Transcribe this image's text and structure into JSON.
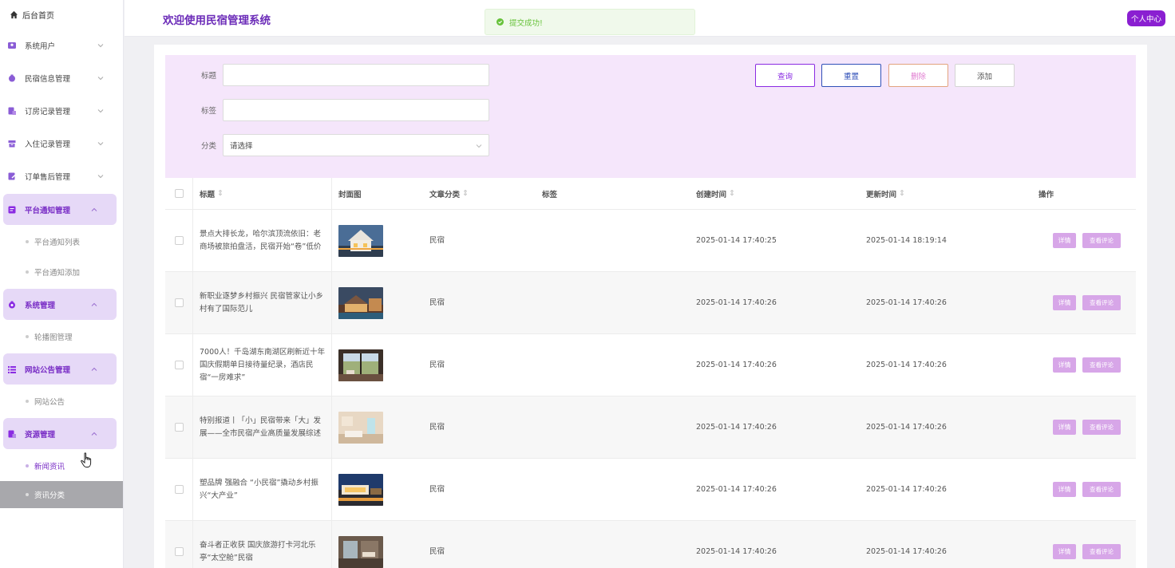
{
  "sidebar": {
    "home_label": "后台首页",
    "menu": [
      {
        "label": "系统用户"
      },
      {
        "label": "民宿信息管理"
      },
      {
        "label": "订房记录管理"
      },
      {
        "label": "入住记录管理"
      },
      {
        "label": "订单售后管理"
      },
      {
        "label": "平台通知管理",
        "sub": [
          "平台通知列表",
          "平台通知添加"
        ]
      },
      {
        "label": "系统管理",
        "sub": [
          "轮播图管理"
        ]
      },
      {
        "label": "网站公告管理",
        "sub": [
          "网站公告"
        ]
      },
      {
        "label": "资源管理",
        "sub": [
          "新闻资讯",
          "资讯分类"
        ]
      }
    ]
  },
  "header": {
    "title": "欢迎使用民宿管理系统",
    "toast": "提交成功!",
    "profile_label": "个人中心"
  },
  "filter": {
    "title_label": "标题",
    "title_value": "",
    "tag_label": "标签",
    "tag_value": "",
    "category_label": "分类",
    "category_value": "请选择",
    "buttons": {
      "search": "查询",
      "reset": "重置",
      "delete": "删除",
      "add": "添加"
    }
  },
  "table": {
    "headers": {
      "title": "标题",
      "cover": "封面图",
      "category": "文章分类",
      "tags": "标签",
      "created": "创建时间",
      "updated": "更新时间",
      "actions": "操作"
    },
    "sort_glyph": "⇕",
    "detail_label": "详情",
    "comment_label": "查看评论",
    "rows": [
      {
        "title": "景点大排长龙，哈尔滨顶流依旧：老商场被旅拍盘活，民宿开始“卷”低价",
        "category": "民宿",
        "tags": "",
        "created": "2025-01-14 17:40:25",
        "updated": "2025-01-14 18:19:14"
      },
      {
        "title": "新职业逐梦乡村振兴 民宿管家让小乡村有了国际范儿",
        "category": "民宿",
        "tags": "",
        "created": "2025-01-14 17:40:26",
        "updated": "2025-01-14 17:40:26"
      },
      {
        "title": "7000人！千岛湖东南湖区刷新近十年国庆假期单日接待量纪录，酒店民宿“一房难求”",
        "category": "民宿",
        "tags": "",
        "created": "2025-01-14 17:40:26",
        "updated": "2025-01-14 17:40:26"
      },
      {
        "title": "特别报道丨「小」民宿带来「大」发展——全市民宿产业高质量发展综述",
        "category": "民宿",
        "tags": "",
        "created": "2025-01-14 17:40:26",
        "updated": "2025-01-14 17:40:26"
      },
      {
        "title": "塑品牌 强融合 “小民宿”撬动乡村振兴“大产业”",
        "category": "民宿",
        "tags": "",
        "created": "2025-01-14 17:40:26",
        "updated": "2025-01-14 17:40:26"
      },
      {
        "title": "奋斗者正收获 国庆旅游打卡河北乐亭“太空舱”民宿",
        "category": "民宿",
        "tags": "",
        "created": "2025-01-14 17:40:26",
        "updated": "2025-01-14 17:40:26"
      }
    ]
  },
  "colors": {
    "accent": "#8a1fd1",
    "brand_text": "#6b2bb8",
    "filter_bg": "#f5e6fb",
    "success": "#67c23a"
  }
}
